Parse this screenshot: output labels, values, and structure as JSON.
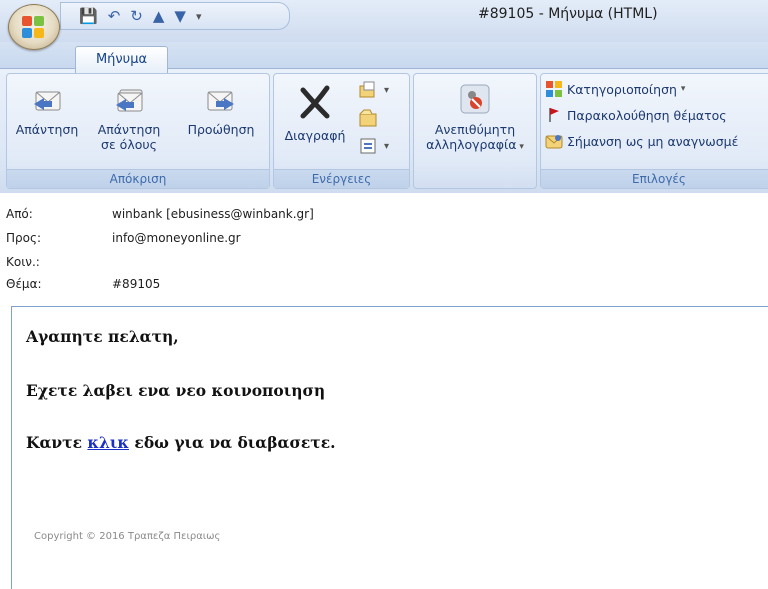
{
  "window": {
    "title": "#89105 - Μήνυμα (HTML)"
  },
  "quick_access": {
    "icons": [
      "save-icon",
      "undo-icon",
      "redo-icon",
      "up-arrow-icon",
      "down-arrow-icon",
      "customize-icon"
    ]
  },
  "ribbon": {
    "tab": "Μήνυμα",
    "groups": {
      "respond": {
        "label": "Απόκριση",
        "reply": "Απάντηση",
        "reply_all_1": "Απάντηση",
        "reply_all_2": "σε όλους",
        "forward": "Προώθηση"
      },
      "actions": {
        "label": "Ενέργειες",
        "delete": "Διαγραφή"
      },
      "junk": {
        "label_1": "Ανεπιθύμητη",
        "label_2": "αλληλογραφία"
      },
      "options": {
        "label": "Επιλογές",
        "categorize": "Κατηγοριοποίηση",
        "follow_up": "Παρακολούθηση θέματος",
        "mark_unread": "Σήμανση ως μη αναγνωσμέ"
      }
    }
  },
  "headers": {
    "from_label": "Από:",
    "from_value": "winbank [ebusiness@winbank.gr]",
    "to_label": "Προς:",
    "to_value": "info@moneyonline.gr",
    "cc_label": "Κοιν.:",
    "cc_value": "",
    "subject_label": "Θέμα:",
    "subject_value": "#89105"
  },
  "body": {
    "greeting": "Αγαπητε πελατη,",
    "line2": "Εχετε λαβει ενα νεο κοινοποιηση",
    "line3_prefix": "Καντε ",
    "line3_link": "κλικ",
    "line3_suffix": " εδω για να διαβασετε.",
    "copyright": "Copyright © 2016 Τραπεζα Πειραιως"
  },
  "colors": {
    "ribbon_bg": "#dce7f5",
    "group_label": "#3e6aaa",
    "link": "#1a2fc4"
  }
}
